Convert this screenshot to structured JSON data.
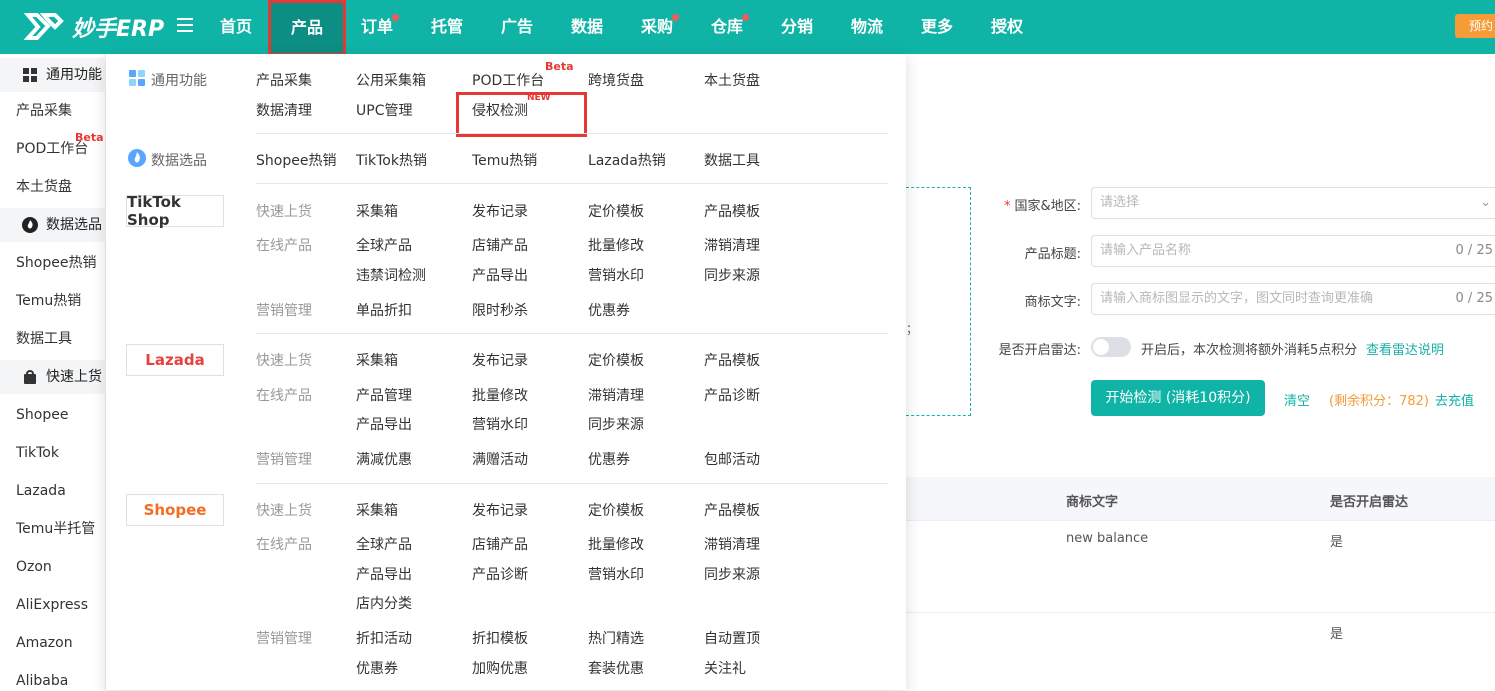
{
  "app": {
    "logo_text": "妙手ERP"
  },
  "nav": [
    {
      "label": "首页",
      "dot": false
    },
    {
      "label": "产品",
      "dot": false,
      "active": true
    },
    {
      "label": "订单",
      "dot": true
    },
    {
      "label": "托管",
      "dot": false
    },
    {
      "label": "广告",
      "dot": false
    },
    {
      "label": "数据",
      "dot": false
    },
    {
      "label": "采购",
      "dot": true
    },
    {
      "label": "仓库",
      "dot": true
    },
    {
      "label": "分销",
      "dot": false
    },
    {
      "label": "物流",
      "dot": false
    },
    {
      "label": "更多",
      "dot": false
    },
    {
      "label": "授权",
      "dot": false
    }
  ],
  "top_right_button": "预约",
  "sidebar": {
    "sections": [
      {
        "label": "通用功能",
        "icon": "grid-icon"
      },
      {
        "label": "数据选品",
        "icon": "fire-icon"
      },
      {
        "label": "快速上货",
        "icon": "bag-icon"
      }
    ],
    "items": [
      "产品采集",
      "POD工作台",
      "本土货盘",
      "Shopee热销",
      "Temu热销",
      "数据工具",
      "Shopee",
      "TikTok",
      "Lazada",
      "Temu半托管",
      "Ozon",
      "AliExpress",
      "Amazon",
      "Alibaba"
    ],
    "beta": "Beta"
  },
  "dropdown": {
    "general_title": "通用功能",
    "general_links": [
      "产品采集",
      "公用采集箱",
      "POD工作台",
      "跨境货盘",
      "本土货盘",
      "数据清理",
      "UPC管理",
      "侵权检测"
    ],
    "data_title": "数据选品",
    "data_links": [
      "Shopee热销",
      "TikTok热销",
      "Temu热销",
      "Lazada热销",
      "数据工具"
    ],
    "beta": "Beta",
    "new": "NEW",
    "tiktok": {
      "logo": "TikTok Shop",
      "groups": [
        {
          "label": "快速上货",
          "links": [
            "采集箱",
            "发布记录",
            "定价模板",
            "产品模板"
          ]
        },
        {
          "label": "在线产品",
          "links": [
            "全球产品",
            "店铺产品",
            "批量修改",
            "滞销清理",
            "违禁词检测",
            "产品导出",
            "营销水印",
            "同步来源"
          ]
        },
        {
          "label": "营销管理",
          "links": [
            "单品折扣",
            "限时秒杀",
            "优惠券"
          ]
        }
      ]
    },
    "lazada": {
      "logo": "Lazada",
      "groups": [
        {
          "label": "快速上货",
          "links": [
            "采集箱",
            "发布记录",
            "定价模板",
            "产品模板"
          ]
        },
        {
          "label": "在线产品",
          "links": [
            "产品管理",
            "批量修改",
            "滞销清理",
            "产品诊断",
            "产品导出",
            "营销水印",
            "同步来源"
          ]
        },
        {
          "label": "营销管理",
          "links": [
            "满减优惠",
            "满赠活动",
            "优惠券",
            "包邮活动"
          ]
        }
      ]
    },
    "shopee": {
      "logo": "Shopee",
      "groups": [
        {
          "label": "快速上货",
          "links": [
            "采集箱",
            "发布记录",
            "定价模板",
            "产品模板"
          ]
        },
        {
          "label": "在线产品",
          "links": [
            "全球产品",
            "店铺产品",
            "批量修改",
            "滞销清理",
            "产品导出",
            "产品诊断",
            "营销水印",
            "同步来源",
            "店内分类"
          ]
        },
        {
          "label": "营销管理",
          "links": [
            "折扣活动",
            "折扣模板",
            "热门精选",
            "自动置顶",
            "优惠券",
            "加购优惠",
            "套装优惠",
            "关注礼"
          ]
        }
      ]
    }
  },
  "form": {
    "country_label": "国家&地区:",
    "country_placeholder": "请选择",
    "title_label": "产品标题:",
    "title_placeholder": "请输入产品名称",
    "title_count": "0 / 25",
    "brand_label": "商标文字:",
    "brand_placeholder": "请输入商标图显示的文字，图文同时查询更准确",
    "brand_count": "0 / 25",
    "radar_label": "是否开启雷达:",
    "radar_text": "开启后，本次检测将额外消耗5点积分",
    "radar_link": "查看雷达说明",
    "start_button": "开始检测 (消耗10积分)",
    "clear": "清空",
    "points": "(剩余积分：782)",
    "recharge": "去充值",
    "left_hint": "；"
  },
  "table": {
    "headers": [
      "商标文字",
      "是否开启雷达"
    ],
    "rows": [
      [
        "new balance",
        "是"
      ],
      [
        "",
        "是"
      ]
    ]
  },
  "colors": {
    "brand": "#10b4a6",
    "highlight": "#e53935",
    "orange": "#f59b37"
  }
}
